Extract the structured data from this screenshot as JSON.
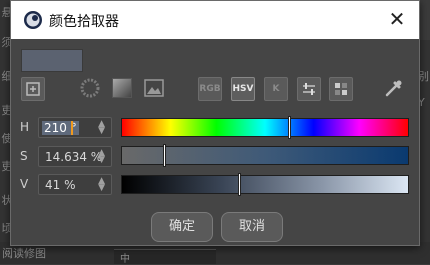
{
  "dialog": {
    "title": "颜色拾取器"
  },
  "current_color": "#5b6270",
  "toolbar": {
    "items": [
      {
        "name": "eyedropper-grid"
      },
      {
        "name": "color-wheel"
      },
      {
        "name": "spectrum"
      },
      {
        "name": "image-picker"
      },
      {
        "label": "RGB"
      },
      {
        "label": "HSV",
        "active": true
      },
      {
        "label": "K"
      },
      {
        "name": "mixer"
      },
      {
        "name": "swatches"
      },
      {
        "name": "eyedropper"
      }
    ]
  },
  "channels": {
    "h": {
      "label": "H",
      "value": "210 °",
      "fraction": 0.583
    },
    "s": {
      "label": "S",
      "value": "14.634 %",
      "fraction": 0.146
    },
    "v": {
      "label": "V",
      "value": "41 %",
      "fraction": 0.41
    }
  },
  "buttons": {
    "ok": "确定",
    "cancel": "取消"
  },
  "background": {
    "left_chars": [
      "悬",
      "须",
      "细",
      "吏",
      "使",
      "吏",
      "状",
      "顷"
    ],
    "right_chars": [
      "别",
      "Y"
    ],
    "bottom_label": "阅读修图",
    "bottom_field": "中"
  }
}
